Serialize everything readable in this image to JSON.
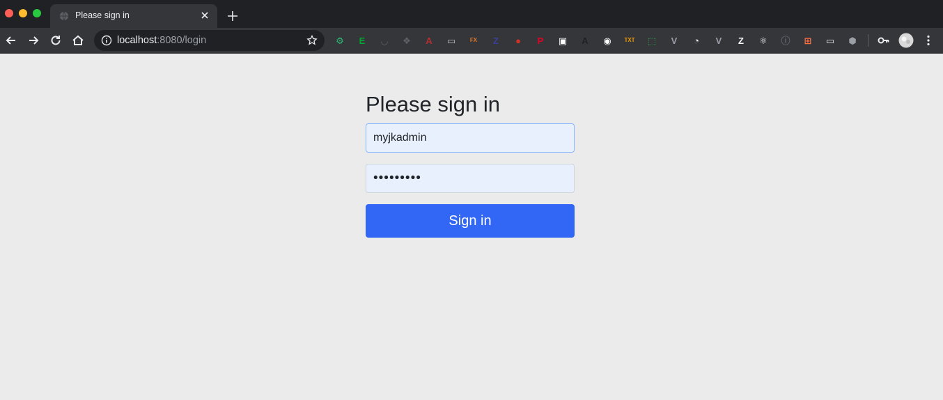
{
  "browser": {
    "tab": {
      "title": "Please sign in"
    },
    "address_bar": {
      "host": "localhost",
      "rest": ":8080/login"
    },
    "extensions": [
      {
        "name": "extension-1",
        "color": "#2bb673",
        "glyph": "⚙"
      },
      {
        "name": "evernote",
        "color": "#00a82d",
        "glyph": "E"
      },
      {
        "name": "pocket",
        "color": "#5f6368",
        "glyph": "◡"
      },
      {
        "name": "dropbox",
        "color": "#5f6368",
        "glyph": "❖"
      },
      {
        "name": "angular",
        "color": "#b52e31",
        "glyph": "A"
      },
      {
        "name": "extension-5",
        "color": "#bdbdbd",
        "glyph": "▭"
      },
      {
        "name": "extension-6",
        "color": "#e37a2b",
        "glyph": "FX"
      },
      {
        "name": "zotero",
        "color": "#3b3f99",
        "glyph": "Z"
      },
      {
        "name": "extension-8",
        "color": "#d93025",
        "glyph": "●"
      },
      {
        "name": "pinterest",
        "color": "#e60023",
        "glyph": "P"
      },
      {
        "name": "extension-10",
        "color": "#ffffff",
        "glyph": "▣"
      },
      {
        "name": "extension-11",
        "color": "#202124",
        "glyph": "A"
      },
      {
        "name": "extension-12",
        "color": "#ffffff",
        "glyph": "◉"
      },
      {
        "name": "extension-13",
        "color": "#f29900",
        "glyph": "TXT"
      },
      {
        "name": "extension-14",
        "color": "#34a853",
        "glyph": "⬚"
      },
      {
        "name": "vue",
        "color": "#9aa0a6",
        "glyph": "V"
      },
      {
        "name": "extension-16",
        "color": "#ffffff",
        "glyph": "◔"
      },
      {
        "name": "vue-2",
        "color": "#9aa0a6",
        "glyph": "V"
      },
      {
        "name": "extension-18",
        "color": "#ffffff",
        "glyph": "Z"
      },
      {
        "name": "react",
        "color": "#e8eaed",
        "glyph": "⚛"
      },
      {
        "name": "extension-20",
        "color": "#5f6368",
        "glyph": "ⓘ"
      },
      {
        "name": "extension-21",
        "color": "#ff7043",
        "glyph": "⊞"
      },
      {
        "name": "extension-22",
        "color": "#e8eaed",
        "glyph": "▭"
      },
      {
        "name": "extension-23",
        "color": "#9aa0a6",
        "glyph": "⬢"
      }
    ]
  },
  "login": {
    "heading": "Please sign in",
    "username_value": "myjkadmin",
    "password_value": "•••••••••",
    "submit_label": "Sign in"
  },
  "colors": {
    "page_background": "#ebebeb",
    "button_primary": "#3266f5",
    "input_autofill": "#e8f0fe"
  }
}
